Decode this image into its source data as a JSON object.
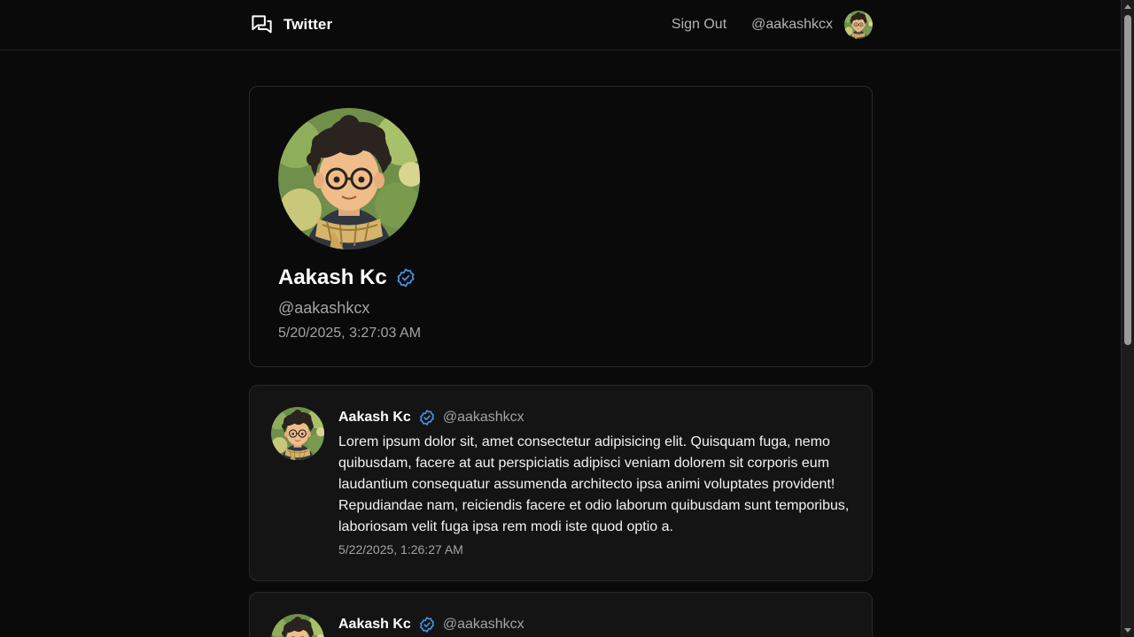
{
  "nav": {
    "brand": "Twitter",
    "brand_icon": "chat-bubbles-icon",
    "sign_out_label": "Sign Out",
    "user_handle": "@aakashkcx"
  },
  "profile": {
    "name": "Aakash Kc",
    "handle": "@aakashkcx",
    "joined": "5/20/2025, 3:27:03 AM",
    "verified_icon": "verified-badge-icon"
  },
  "tweets": [
    {
      "name": "Aakash Kc",
      "handle": "@aakashkcx",
      "text": "Lorem ipsum dolor sit, amet consectetur adipisicing elit. Quisquam fuga, nemo quibusdam, facere at aut perspiciatis adipisci veniam dolorem sit corporis eum laudantium consequatur assumenda architecto ipsa animi voluptates provident! Repudiandae nam, reiciendis facere et odio laborum quibusdam sunt temporibus, laboriosam velit fuga ipsa rem modi iste quod optio a.",
      "date": "5/22/2025, 1:26:27 AM"
    },
    {
      "name": "Aakash Kc",
      "handle": "@aakashkcx"
    }
  ],
  "colors": {
    "background": "#0a0a0a",
    "card": "#141414",
    "border": "#2a2a2a",
    "verified": "#4a90e2",
    "muted_text": "#a3a3a3"
  }
}
